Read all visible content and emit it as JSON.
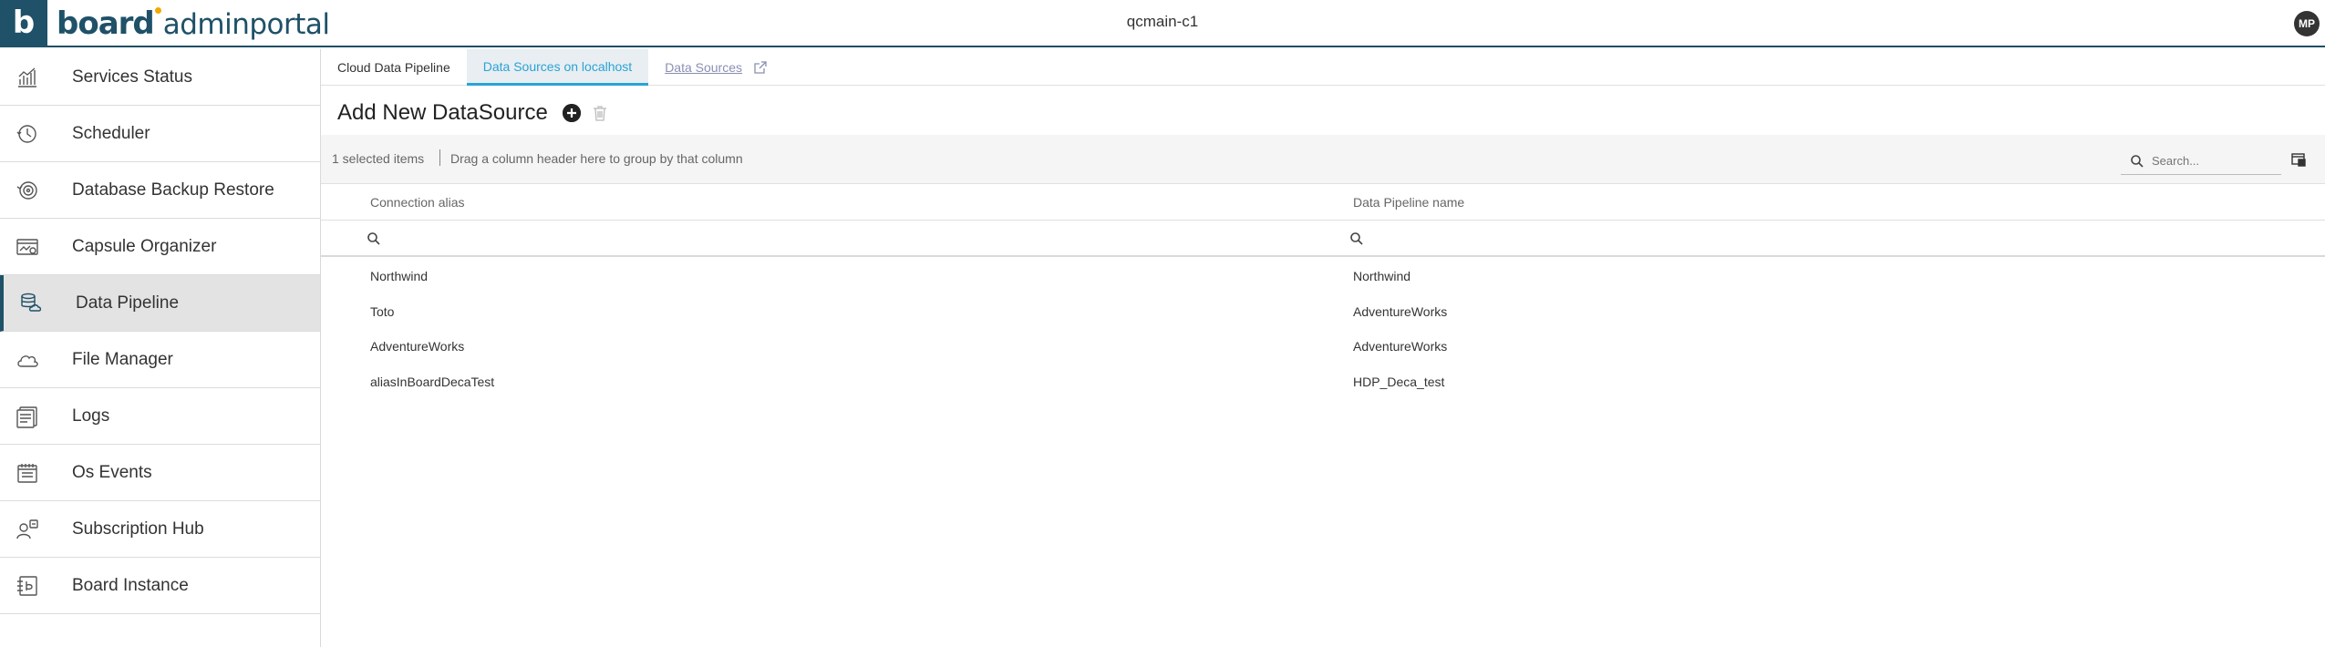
{
  "header": {
    "logo_letter": "b",
    "brand_bold": "board",
    "brand_light": "adminportal",
    "instance": "qcmain-c1",
    "avatar": "MP"
  },
  "sidebar": {
    "items": [
      {
        "label": "Services Status",
        "icon": "bar-chart-icon"
      },
      {
        "label": "Scheduler",
        "icon": "clock-icon"
      },
      {
        "label": "Database Backup Restore",
        "icon": "backup-icon"
      },
      {
        "label": "Capsule Organizer",
        "icon": "capsule-icon"
      },
      {
        "label": "Data Pipeline",
        "icon": "database-cloud-icon",
        "active": true
      },
      {
        "label": "File Manager",
        "icon": "cloud-icon"
      },
      {
        "label": "Logs",
        "icon": "logs-icon"
      },
      {
        "label": "Os Events",
        "icon": "calendar-icon"
      },
      {
        "label": "Subscription Hub",
        "icon": "subscription-icon"
      },
      {
        "label": "Board Instance",
        "icon": "board-instance-icon"
      }
    ]
  },
  "tabs": [
    {
      "label": "Cloud Data Pipeline"
    },
    {
      "label": "Data Sources on localhost",
      "active": true
    },
    {
      "label": "Data Sources",
      "external": true
    }
  ],
  "page": {
    "title": "Add New DataSource"
  },
  "grid": {
    "selected": "1 selected items",
    "group_hint": "Drag a column header here to group by that column",
    "search_placeholder": "Search...",
    "columns": [
      "Connection alias",
      "Data Pipeline name"
    ],
    "rows": [
      [
        "Northwind",
        "Northwind"
      ],
      [
        "Toto",
        "AdventureWorks"
      ],
      [
        "AdventureWorks",
        "AdventureWorks"
      ],
      [
        "aliasInBoardDecaTest",
        "HDP_Deca_test"
      ]
    ]
  },
  "colors": {
    "brand": "#1f5168",
    "accent": "#2aa3d6",
    "brand_dot": "#f2a900"
  }
}
